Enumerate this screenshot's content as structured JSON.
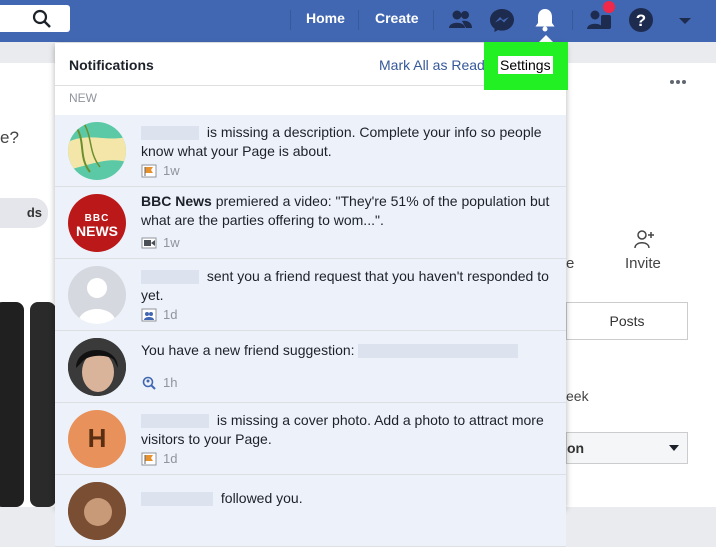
{
  "topbar": {
    "home": "Home",
    "create": "Create"
  },
  "background": {
    "left_text": "e?",
    "left_pill": "ds",
    "right_invite": "Invite",
    "right_partial": "e",
    "posts_label": "Posts",
    "week_partial": "eek",
    "on_partial": "on"
  },
  "notifications": {
    "title": "Notifications",
    "mark_all": "Mark All as Read",
    "settings": "Settings",
    "section": "NEW",
    "items": [
      {
        "name": "",
        "text": "is missing a description. Complete your info so people know what your Page is about.",
        "time": "1w",
        "meta_icon": "page-flag-icon"
      },
      {
        "name": "BBC News",
        "text": "premiered a video: \"They're 51% of the population but what are the parties offering to wom...\".",
        "time": "1w",
        "meta_icon": "video-camera-icon"
      },
      {
        "name": "",
        "text": "sent you a friend request that you haven't responded to yet.",
        "time": "1d",
        "meta_icon": "friends-icon"
      },
      {
        "name": "",
        "text": "You have a new friend suggestion:",
        "time": "1h",
        "meta_icon": "friend-search-icon"
      },
      {
        "name": "",
        "text": "is missing a cover photo. Add a photo to attract more visitors to your Page.",
        "time": "1d",
        "meta_icon": "page-flag-icon"
      },
      {
        "name": "",
        "text": "followed you.",
        "time": "",
        "meta_icon": ""
      }
    ],
    "bbc_logo": [
      "BBC",
      "NEWS"
    ],
    "h_avatar_letter": "H"
  },
  "colors": {
    "brand": "#4267b2",
    "highlight": "#22f022",
    "unread": "#edf2fa"
  }
}
